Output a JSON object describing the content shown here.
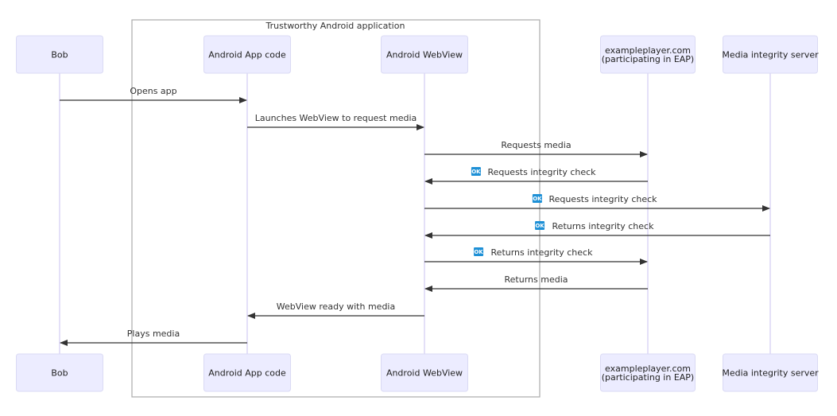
{
  "diagram": {
    "type": "sequence",
    "group": {
      "label": "Trustworthy Android application",
      "members": [
        "app",
        "webview"
      ]
    },
    "actors": [
      {
        "id": "bob",
        "lines": [
          "Bob"
        ]
      },
      {
        "id": "app",
        "lines": [
          "Android App code"
        ]
      },
      {
        "id": "webview",
        "lines": [
          "Android WebView"
        ]
      },
      {
        "id": "example",
        "lines": [
          "exampleplayer.com",
          "(participating in EAP)"
        ]
      },
      {
        "id": "media",
        "lines": [
          "Media integrity server"
        ]
      }
    ],
    "messages": [
      {
        "from": "bob",
        "to": "app",
        "label": "Opens app",
        "badge": false
      },
      {
        "from": "app",
        "to": "webview",
        "label": "Launches WebView to request media",
        "badge": false
      },
      {
        "from": "webview",
        "to": "example",
        "label": "Requests media",
        "badge": false
      },
      {
        "from": "example",
        "to": "webview",
        "label": "Requests integrity check",
        "badge": true
      },
      {
        "from": "webview",
        "to": "media",
        "label": "Requests integrity check",
        "badge": true
      },
      {
        "from": "media",
        "to": "webview",
        "label": "Returns integrity check",
        "badge": true
      },
      {
        "from": "webview",
        "to": "example",
        "label": "Returns integrity check",
        "badge": true
      },
      {
        "from": "example",
        "to": "webview",
        "label": "Returns media",
        "badge": false
      },
      {
        "from": "webview",
        "to": "app",
        "label": "WebView ready with media",
        "badge": false
      },
      {
        "from": "app",
        "to": "bob",
        "label": "Plays media",
        "badge": false
      }
    ],
    "badge_text": "OK",
    "colors": {
      "actor_fill": "#ECECFF",
      "badge": "#1E90D6",
      "line": "#333333"
    }
  }
}
